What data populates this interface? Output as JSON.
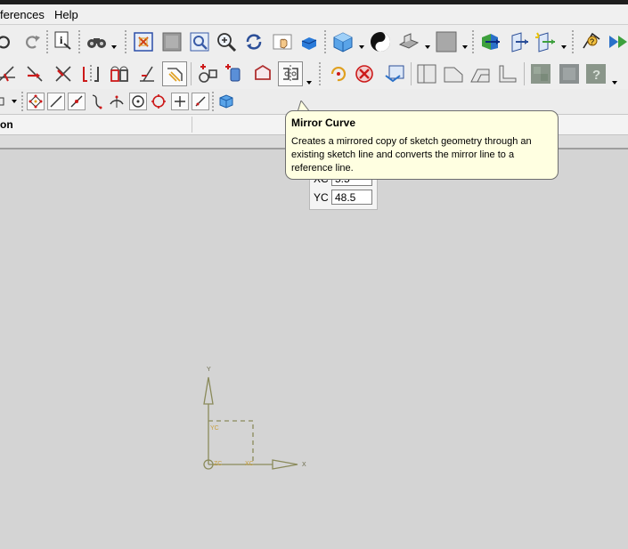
{
  "menubar": {
    "items": [
      "ferences",
      "Help"
    ]
  },
  "header": {
    "column_label": "on"
  },
  "coords": {
    "xc_label": "XC",
    "xc_value": "5.5",
    "yc_label": "YC",
    "yc_value": "48.5"
  },
  "tooltip": {
    "title": "Mirror Curve",
    "text": "Creates a mirrored copy of sketch geometry through an existing sketch line and converts the mirror line to a reference line."
  },
  "colors": {
    "tooltip_bg": "#ffffe1",
    "axis": "#8a8a5a",
    "canvas": "#d4d4d4"
  },
  "icons": {
    "toolbar1": [
      "undo-icon",
      "redo-icon",
      "information-icon",
      "binoculars-icon",
      "fit-icon",
      "zoom-window-icon",
      "zoom-icon",
      "magnify-icon",
      "rotate-icon",
      "pan-icon",
      "shaded-view-icon",
      "orient-view-icon",
      "render-style-icon",
      "view-style-icon",
      "background-color-icon",
      "wcs-icon",
      "display-icon",
      "highlight-icon",
      "measure-icon",
      "arrow-icon"
    ],
    "toolbar2": [
      "quick-trim-icon",
      "extend-icon",
      "trim-corner-icon",
      "mirror-icon",
      "offset-icon",
      "fillet-icon",
      "chamfer-icon",
      "make-corner-icon",
      "pattern-icon",
      "polygon-icon",
      "mirror-curve-icon",
      "constraint-icon",
      "delete-icon",
      "convert-icon",
      "sketch-view-icon",
      "profile-icon",
      "rectangle-icon",
      "corner-icon",
      "texture-icon",
      "blend-icon",
      "help-icon"
    ],
    "toolbar3": [
      "selection-icon",
      "snap-endpoint-icon",
      "snap-line-icon",
      "snap-midpoint-icon",
      "curve-icon",
      "tangent-icon",
      "circle-center-icon",
      "quadrant-icon",
      "intersect-icon",
      "slash-icon",
      "cube-icon"
    ]
  }
}
